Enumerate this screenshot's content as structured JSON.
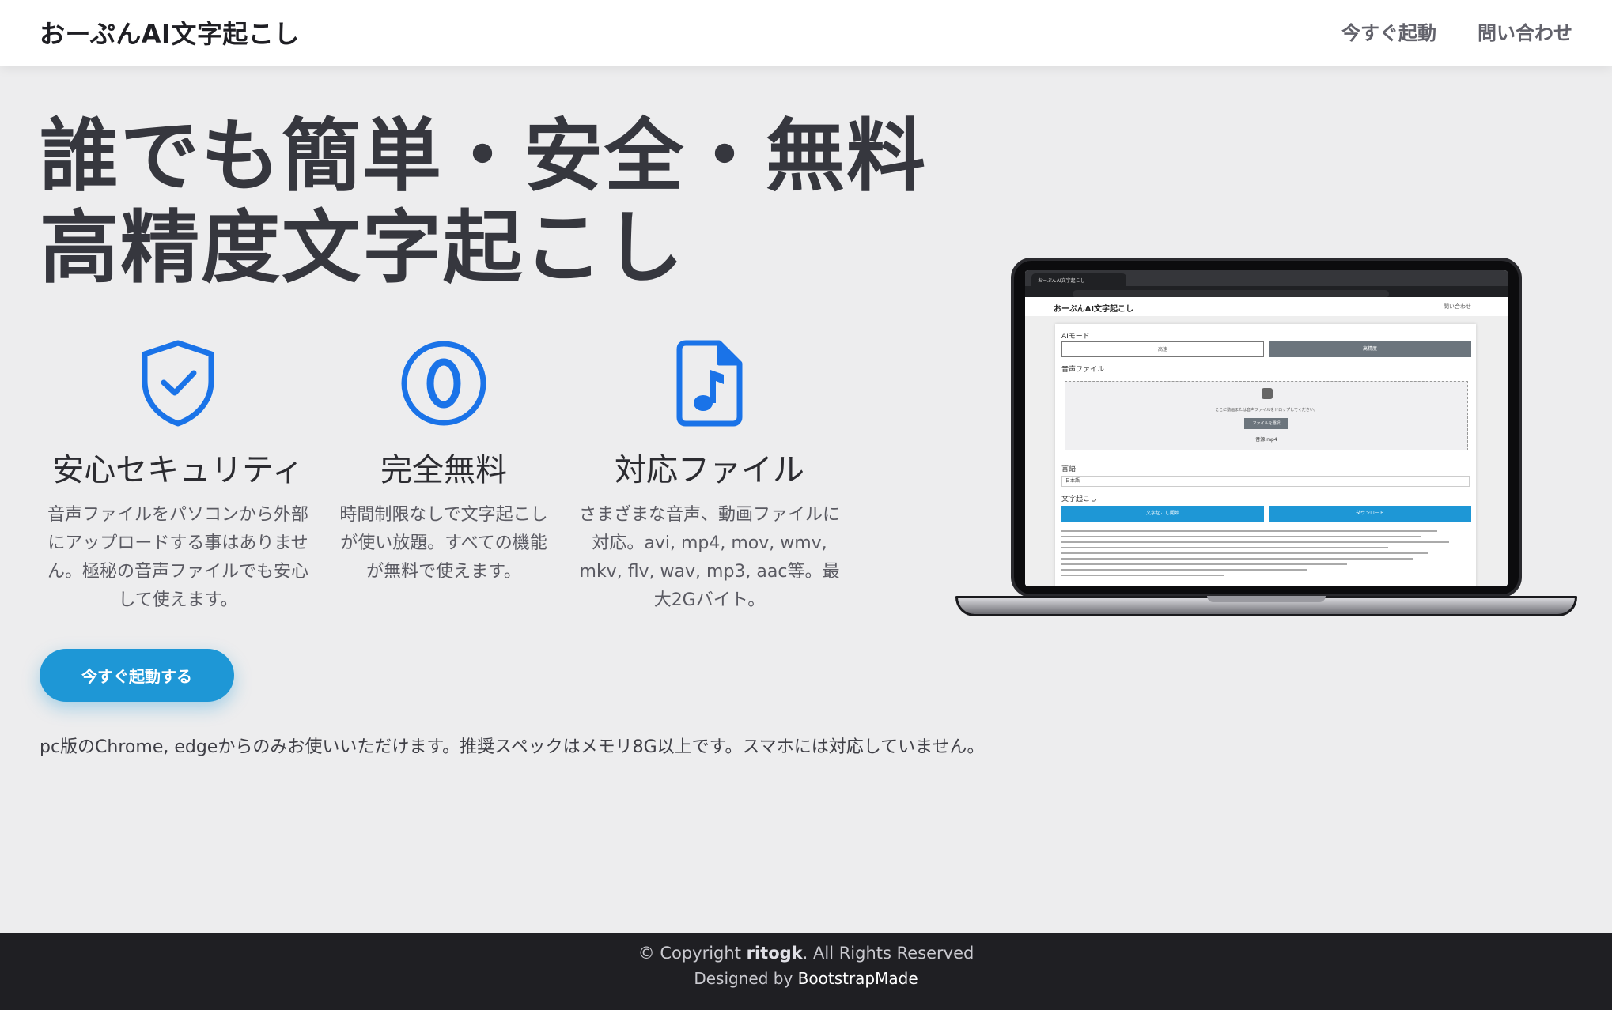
{
  "header": {
    "brand": "おーぷんAI文字起こし",
    "nav": [
      "今すぐ起動",
      "問い合わせ"
    ]
  },
  "hero": {
    "title_line1": "誰でも簡単・安全・無料",
    "title_line2": "高精度文字起こし"
  },
  "features": [
    {
      "icon": "shield-check-icon",
      "title": "安心セキュリティ",
      "text": "音声ファイルをパソコンから外部にアップロードする事はありません。極秘の音声ファイルでも安心して使えます。"
    },
    {
      "icon": "zero-circle-icon",
      "title": "完全無料",
      "text": "時間制限なしで文字起こしが使い放題。すべての機能が無料で使えます。"
    },
    {
      "icon": "music-file-icon",
      "title": "対応ファイル",
      "text": "さまざまな音声、動画ファイルに対応。avi, mp4, mov, wmv, mkv, flv, wav, mp3, aac等。最大2Gバイト。"
    }
  ],
  "cta": {
    "label": "今すぐ起動する"
  },
  "note": "pc版のChrome, edgeからのみお使いいただけます。推奨スペックはメモリ8G以上です。スマホには対応していません。",
  "screenshot": {
    "tab_title": "おーぷんAI文字起こし",
    "brand": "おーぷんAI文字起こし",
    "contact": "問い合わせ",
    "ai_mode_label": "AIモード",
    "btn_fast": "高速",
    "btn_accurate": "高精度",
    "audio_label": "音声ファイル",
    "drop_text": "ここに動画または音声ファイルをドロップしてください。",
    "select_file": "ファイルを選択",
    "file_name": "音源.mp4",
    "language_label": "言語",
    "language_value": "日本語",
    "transcribe_label": "文字起こし",
    "start_button": "文字起こし開始",
    "download_button": "ダウンロード"
  },
  "footer": {
    "copyright_prefix": "© Copyright ",
    "copyright_owner": "ritogk",
    "copyright_suffix": ". All Rights Reserved",
    "designed_prefix": "Designed by ",
    "designed_link": "BootstrapMade"
  },
  "colors": {
    "accent": "#1e97d6",
    "icon_blue": "#1a73e8",
    "background": "#ededee",
    "footer": "#1f1f23"
  }
}
